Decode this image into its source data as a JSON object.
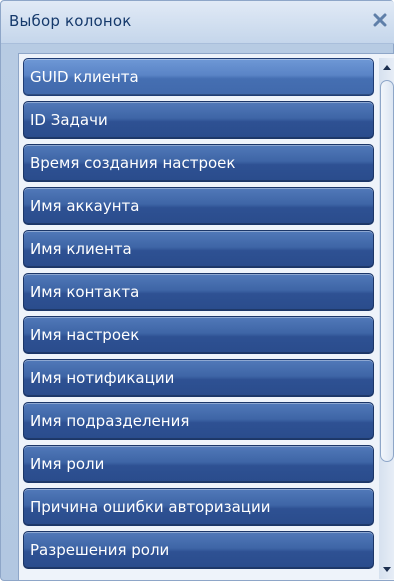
{
  "window": {
    "title": "Выбор колонок",
    "close_icon": "close-icon"
  },
  "columns": [
    {
      "label": "GUID клиента",
      "selected": true
    },
    {
      "label": "ID Задачи",
      "selected": false
    },
    {
      "label": "Время создания настроек",
      "selected": false
    },
    {
      "label": "Имя аккаунта",
      "selected": false
    },
    {
      "label": "Имя клиента",
      "selected": false
    },
    {
      "label": "Имя контакта",
      "selected": false
    },
    {
      "label": "Имя настроек",
      "selected": false
    },
    {
      "label": "Имя нотификации",
      "selected": false
    },
    {
      "label": "Имя подразделения",
      "selected": false
    },
    {
      "label": "Имя роли",
      "selected": false
    },
    {
      "label": "Причина ошибки авторизации",
      "selected": false
    },
    {
      "label": "Разрешения роли",
      "selected": false
    }
  ],
  "scrollbar": {
    "up_icon": "arrow-up-icon",
    "down_icon": "arrow-down-icon",
    "visible_fraction": 0.8
  },
  "colors": {
    "item_background": "#3e65a6",
    "item_selected": "#5a84c6",
    "title_text": "#15396b",
    "panel_background": "#b7cbe3"
  }
}
